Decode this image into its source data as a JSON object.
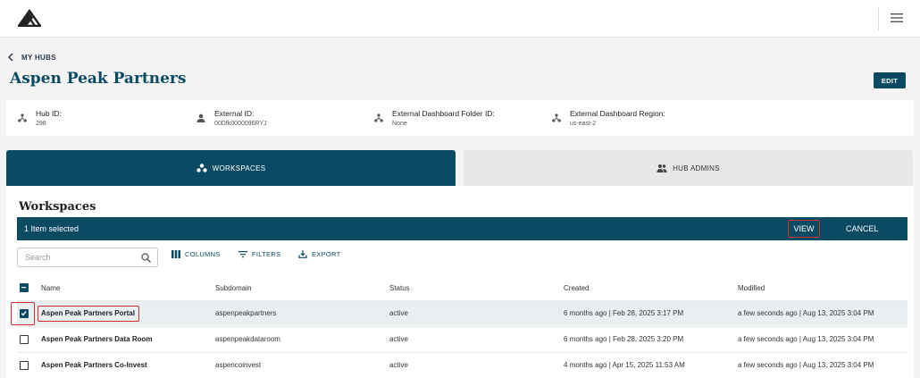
{
  "header": {
    "logo_icon": "mountain-logo-icon",
    "menu_icon": "hamburger-menu-icon"
  },
  "breadcrumb": {
    "back_label": "MY HUBS"
  },
  "page": {
    "title": "Aspen Peak Partners",
    "edit_label": "EDIT"
  },
  "info": [
    {
      "label": "Hub ID:",
      "value": "298",
      "icon": "hub-icon"
    },
    {
      "label": "External ID:",
      "value": "00Dfk0000096RYJ",
      "icon": "person-icon"
    },
    {
      "label": "External Dashboard Folder ID:",
      "value": "None",
      "icon": "hub-icon"
    },
    {
      "label": "External Dashboard Region:",
      "value": "us-east-2",
      "icon": "hub-icon"
    }
  ],
  "tabs": [
    {
      "label": "WORKSPACES",
      "icon": "workspaces-icon",
      "active": true
    },
    {
      "label": "HUB ADMINS",
      "icon": "people-icon",
      "active": false
    }
  ],
  "workspaces": {
    "title": "Workspaces",
    "selection_text": "1 Item selected",
    "view_label": "VIEW",
    "cancel_label": "CANCEL",
    "search_placeholder": "Search",
    "toolbar": {
      "columns_label": "COLUMNS",
      "filters_label": "FILTERS",
      "export_label": "EXPORT"
    },
    "columns": [
      "Name",
      "Subdomain",
      "Status",
      "Created",
      "Modified"
    ],
    "rows": [
      {
        "name": "Aspen Peak Partners Portal",
        "subdomain": "aspenpeakpartners",
        "status": "active",
        "created": "6 months ago | Feb 28, 2025 3:17 PM",
        "modified": "a few seconds ago | Aug 13, 2025 3:04 PM",
        "checked": true
      },
      {
        "name": "Aspen Peak Partners Data Room",
        "subdomain": "aspenpeakdataroom",
        "status": "active",
        "created": "6 months ago | Feb 28, 2025 3:20 PM",
        "modified": "a few seconds ago | Aug 13, 2025 3:04 PM",
        "checked": false
      },
      {
        "name": "Aspen Peak Partners Co-Invest",
        "subdomain": "aspencoinvest",
        "status": "active",
        "created": "4 months ago | Apr 15, 2025 11:53 AM",
        "modified": "a few seconds ago | Aug 13, 2025 3:04 PM",
        "checked": false
      }
    ]
  },
  "colors": {
    "primary": "#0b4a63",
    "highlight": "#d32f2f",
    "tab_inactive": "#e8e7e5"
  }
}
